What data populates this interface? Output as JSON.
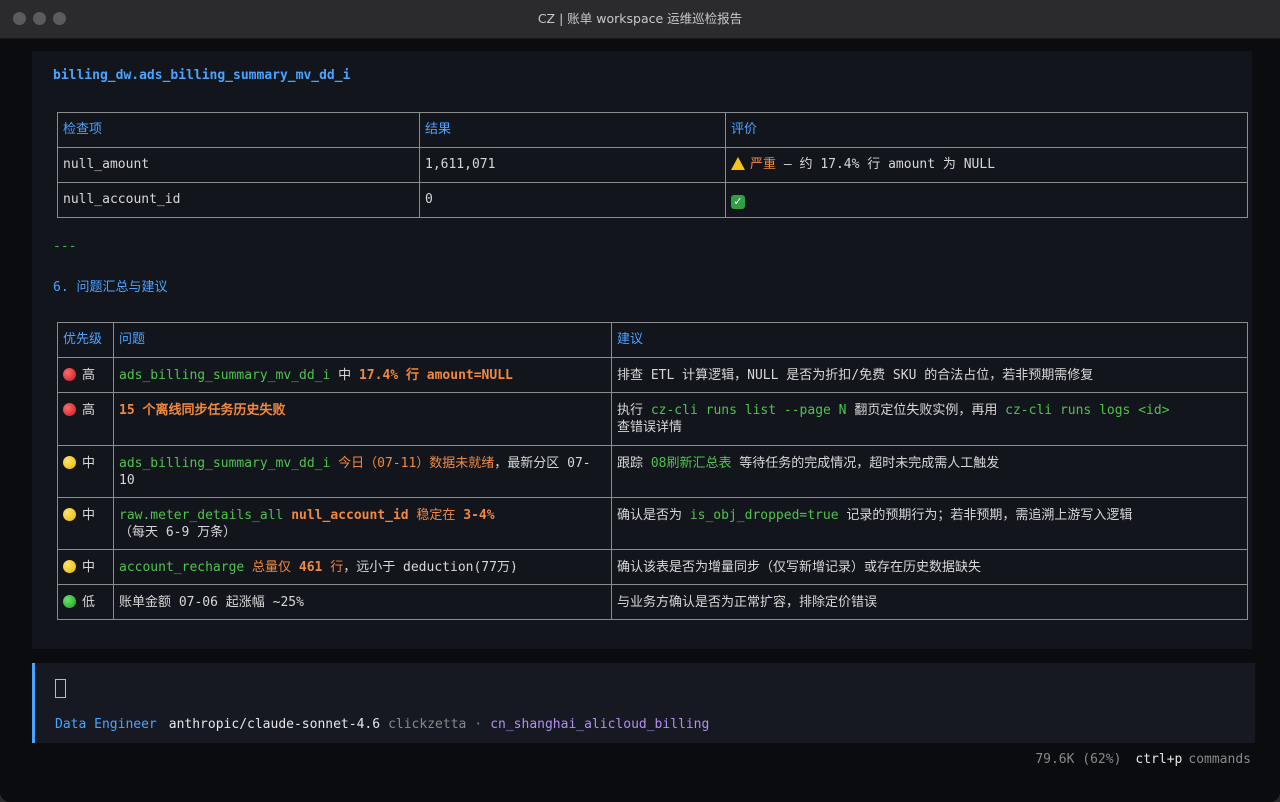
{
  "window": {
    "title": "CZ | 账单 workspace 运维巡检报告"
  },
  "report": {
    "table_name": "billing_dw.ads_billing_summary_mv_dd_i",
    "check_table": {
      "headers": [
        "检查项",
        "结果",
        "评价"
      ],
      "rows": [
        {
          "item": "null_amount",
          "result": "1,611,071",
          "eval_severity": "严重",
          "eval_text": " — 约 17.4% 行 amount 为 NULL"
        },
        {
          "item": "null_account_id",
          "result": "0",
          "eval_icon": "✓"
        }
      ]
    },
    "separator": "---",
    "section_title": "6. 问题汇总与建议",
    "issue_table": {
      "headers": [
        "优先级",
        "问题",
        "建议"
      ],
      "rows": [
        {
          "priority": "高",
          "issue": {
            "a": "ads_billing_summary_mv_dd_i",
            "b": " 中 ",
            "c": "17.4% 行 amount=NULL"
          },
          "advice": {
            "a": "排查 ETL 计算逻辑，NULL 是否为折扣/免费 SKU 的合法占位，若非预期需修复"
          }
        },
        {
          "priority": "高",
          "issue": {
            "a": "15 个离线同步任务历史失败"
          },
          "advice": {
            "a": "执行 ",
            "b": "cz-cli runs list --page N",
            "c": " 翻页定位失败实例，再用 ",
            "d": "cz-cli runs logs <id>",
            "e": "查错误详情"
          }
        },
        {
          "priority": "中",
          "issue": {
            "a": "ads_billing_summary_mv_dd_i",
            "b": " 今日（07-11）数据未就绪",
            "c": "，最新分区 07-10"
          },
          "advice": {
            "a": "跟踪 ",
            "b": "08刷新汇总表",
            "c": " 等待任务的完成情况，超时未完成需人工触发"
          }
        },
        {
          "priority": "中",
          "issue": {
            "a": "raw.meter_details_all",
            "b": " null_account_id",
            "c": " 稳定在 ",
            "d": "3-4%",
            "e": "（每天 6-9 万条）"
          },
          "advice": {
            "a": "确认是否为 ",
            "b": "is_obj_dropped=true",
            "c": " 记录的预期行为；若非预期，需追溯上游写入逻辑"
          }
        },
        {
          "priority": "中",
          "issue": {
            "a": "account_recharge",
            "b": " 总量仅 ",
            "c": "461",
            "d": " 行",
            "e": "，远小于 deduction(77万)"
          },
          "advice": {
            "a": "确认该表是否为增量同步（仅写新增记录）或存在历史数据缺失"
          }
        },
        {
          "priority": "低",
          "issue": {
            "a": "账单金额 07-06 起涨幅 ~25%"
          },
          "advice": {
            "a": "与业务方确认是否为正常扩容，排除定价错误"
          }
        }
      ]
    }
  },
  "status": {
    "role": "Data Engineer",
    "model": "anthropic/claude-sonnet-4.6",
    "workspace": "clickzetta",
    "separator": "·",
    "vcluster": "cn_shanghai_alicloud_billing"
  },
  "footer": {
    "usage": "79.6K (62%)",
    "key": "ctrl+p",
    "commands": "commands"
  },
  "colors": {
    "accent": "#4aa3ff",
    "green": "#4ec24e",
    "orange": "#f0883e",
    "purple": "#b48ef0"
  },
  "icons": {
    "high": "red-circle-icon",
    "medium": "yellow-circle-icon",
    "low": "green-circle-icon",
    "warning": "warning-icon",
    "ok": "check-icon"
  }
}
